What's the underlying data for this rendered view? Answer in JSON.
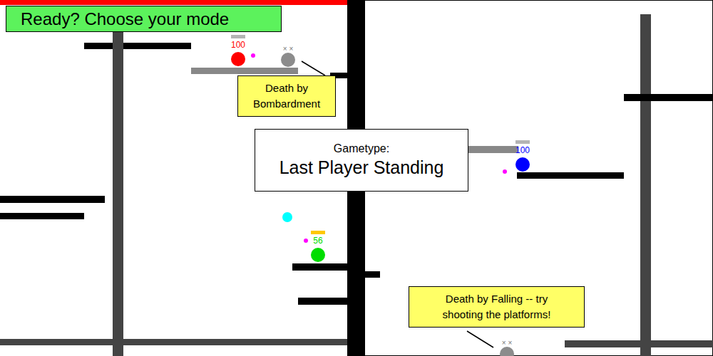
{
  "mode_banner": "Ready? Choose your mode",
  "gametype": {
    "label": "Gametype:",
    "value": "Last Player Standing"
  },
  "players": [
    {
      "kind": "alive",
      "health": "100",
      "color": "#ff0000",
      "bar_color": "#b4b4b4"
    },
    {
      "kind": "dead",
      "eyes": "× ×",
      "color": "#8c8c8c"
    },
    {
      "kind": "alive",
      "health": "100",
      "color": "#0000ff",
      "bar_color": "#b4b4b4"
    },
    {
      "kind": "alive",
      "health": "56",
      "color": "#00dd00",
      "bar_color": "#ffc800"
    },
    {
      "kind": "dead",
      "eyes": "× ×",
      "color": "#8c8c8c"
    }
  ],
  "shots": [
    {
      "kind": "bullet",
      "color": "#ff00ff"
    },
    {
      "kind": "bullet",
      "color": "#ff00ff"
    },
    {
      "kind": "bullet",
      "color": "#ff00ff"
    },
    {
      "kind": "orb",
      "color": "#00ffff"
    }
  ],
  "callouts": [
    {
      "lines": [
        "Death by",
        "Bombardment"
      ]
    },
    {
      "lines": [
        "Death by Falling -- try",
        "shooting the platforms!"
      ]
    }
  ]
}
